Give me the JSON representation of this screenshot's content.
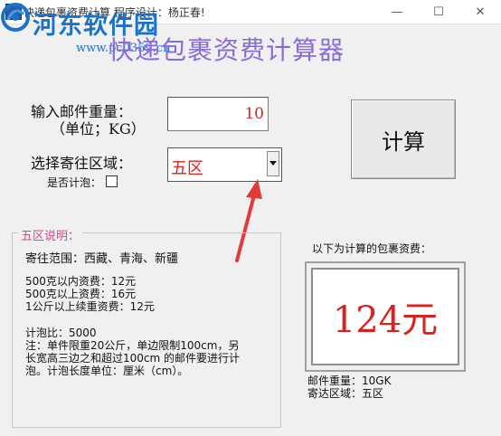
{
  "window": {
    "title": "快递包裹资费计算    程序设计：杨正春!",
    "min_glyph": "—",
    "max_glyph": "☐",
    "close_glyph": "✕"
  },
  "watermark": {
    "site_name": "河东软件园",
    "url": "www.pc0359.cn"
  },
  "app": {
    "heading": "快递包裹资费计算器"
  },
  "form": {
    "weight_label": "输入邮件重量：",
    "unit_label": "（单位；KG）",
    "weight_value": "10",
    "region_label": "选择寄往区域：",
    "region_value": "五区",
    "foam_label": "是否计泡：",
    "foam_checked": false,
    "calc_button": "计算"
  },
  "description": {
    "legend": "五区说明：",
    "scope": "寄往范围：西藏、青海、新疆",
    "price_lines": [
      "500克以内资费：12元",
      "500克以上资费：16元",
      "1公斤以上续重资费：12元"
    ],
    "foam_ratio": "计泡比：5000",
    "notes": [
      "注：单件限重20公斤，单边限制100cm，另",
      "长宽高三边之和超过100cm 的邮件要进行计",
      "泡。计泡长度单位：厘米（cm）。"
    ]
  },
  "result": {
    "caption": "以下为计算的包裹资费：",
    "amount": "124元",
    "mail_weight": "邮件重量：10GK",
    "mail_region": "寄达区域：五区"
  },
  "colors": {
    "accent_red": "#d8221f",
    "heading_purple": "#8a6bd8",
    "watermark_blue": "#1a73c8",
    "legend_pink": "#d04b8a"
  }
}
